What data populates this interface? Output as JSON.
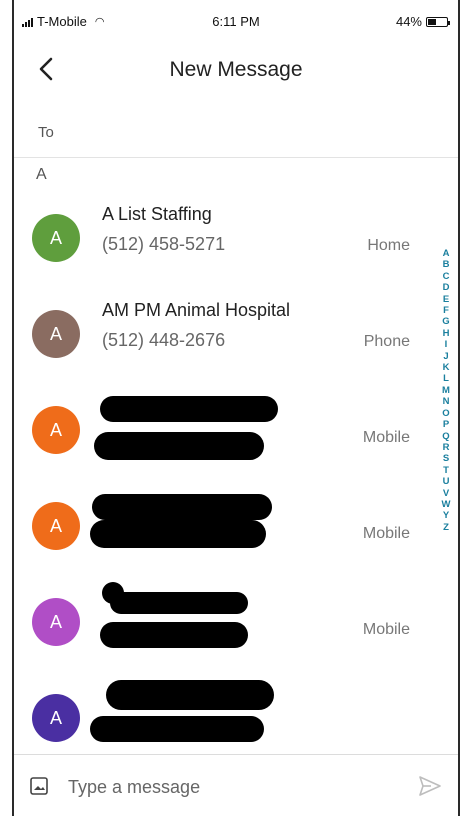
{
  "status_bar": {
    "carrier": "T-Mobile",
    "time": "6:11 PM",
    "battery": "44%",
    "battery_level": 0.44
  },
  "header": {
    "title": "New Message"
  },
  "recipient": {
    "to_label": "To"
  },
  "section": {
    "letter": "A"
  },
  "contacts": [
    {
      "initial": "A",
      "name": "A List Staffing",
      "phone": "(512) 458-5271",
      "type": "Home",
      "avatar_color": "#5f9e3d",
      "redacted": false
    },
    {
      "initial": "A",
      "name": "AM PM Animal Hospital",
      "phone": "(512) 448-2676",
      "type": "Phone",
      "avatar_color": "#8a6c61",
      "redacted": false
    },
    {
      "initial": "A",
      "type": "Mobile",
      "avatar_color": "#ef6c1a",
      "redacted": true
    },
    {
      "initial": "A",
      "type": "Mobile",
      "avatar_color": "#ef6c1a",
      "redacted": true
    },
    {
      "initial": "A",
      "type": "Mobile",
      "avatar_color": "#b04ec6",
      "redacted": true
    },
    {
      "initial": "A",
      "avatar_color": "#4a2fa2",
      "redacted": true
    }
  ],
  "alphabet": [
    "A",
    "B",
    "C",
    "D",
    "E",
    "F",
    "G",
    "H",
    "I",
    "J",
    "K",
    "L",
    "M",
    "N",
    "O",
    "P",
    "Q",
    "R",
    "S",
    "T",
    "U",
    "V",
    "W",
    "Y",
    "Z"
  ],
  "compose": {
    "placeholder": "Type a message"
  },
  "icons": {
    "back": "back-arrow-icon",
    "gallery": "gallery-icon",
    "send": "send-icon"
  }
}
